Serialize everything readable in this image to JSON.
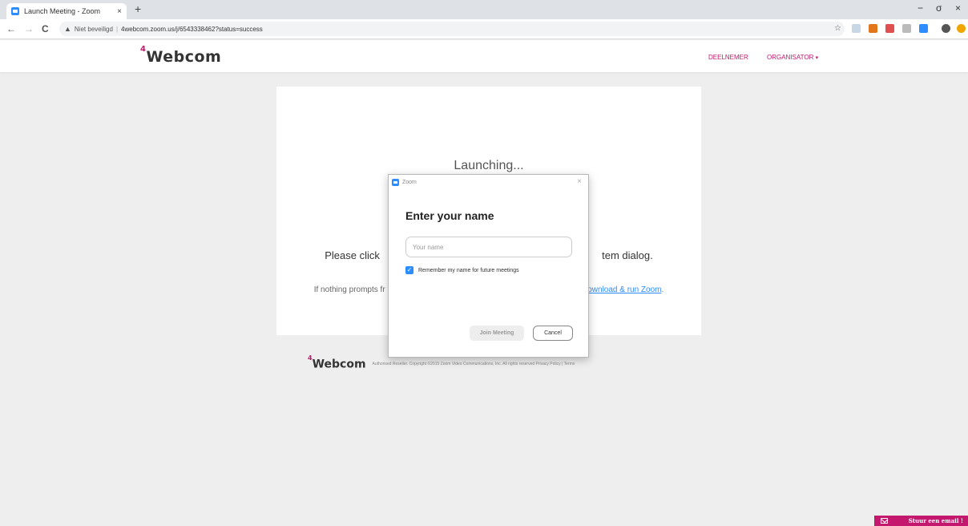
{
  "browser": {
    "tab_title": "Launch Meeting - Zoom",
    "tab_close": "×",
    "new_tab": "+",
    "url": "4webcom.zoom.us/j/6543338462?status=success",
    "security_label": "Niet beveiligd",
    "nav": {
      "back": "←",
      "forward": "→",
      "reload": "C"
    },
    "window": {
      "minimize": "−",
      "maximize": "σ",
      "close": "×"
    }
  },
  "site": {
    "logo_sup": "4",
    "logo_text": "Webcom",
    "nav": [
      {
        "label": "DEELNEMER"
      },
      {
        "label": "ORGANISATOR",
        "caret": "▾"
      }
    ]
  },
  "main": {
    "launching": "Launching...",
    "please_left": "Please click",
    "please_right": "tem dialog.",
    "nothing_left": "If nothing prompts fr",
    "download_link": "ownload & run Zoom",
    "nothing_end": "."
  },
  "dialog": {
    "app_title": "Zoom",
    "heading": "Enter your name",
    "name_placeholder": "Your name",
    "name_value": "",
    "remember_label": "Remember my name for future meetings",
    "remember_checked": true,
    "join_button": "Join Meeting",
    "cancel_button": "Cancel"
  },
  "footer": {
    "logo_sup": "4",
    "logo_text": "Webcom",
    "text": "Authorised Reseller. Copyright ©2015 Zoom Video Communications, Inc. All rights reserved Privacy Policy | Terms"
  },
  "email_button": "Stuur een email !",
  "colors": {
    "brand": "#c3186e",
    "zoom_blue": "#2d8cff"
  }
}
